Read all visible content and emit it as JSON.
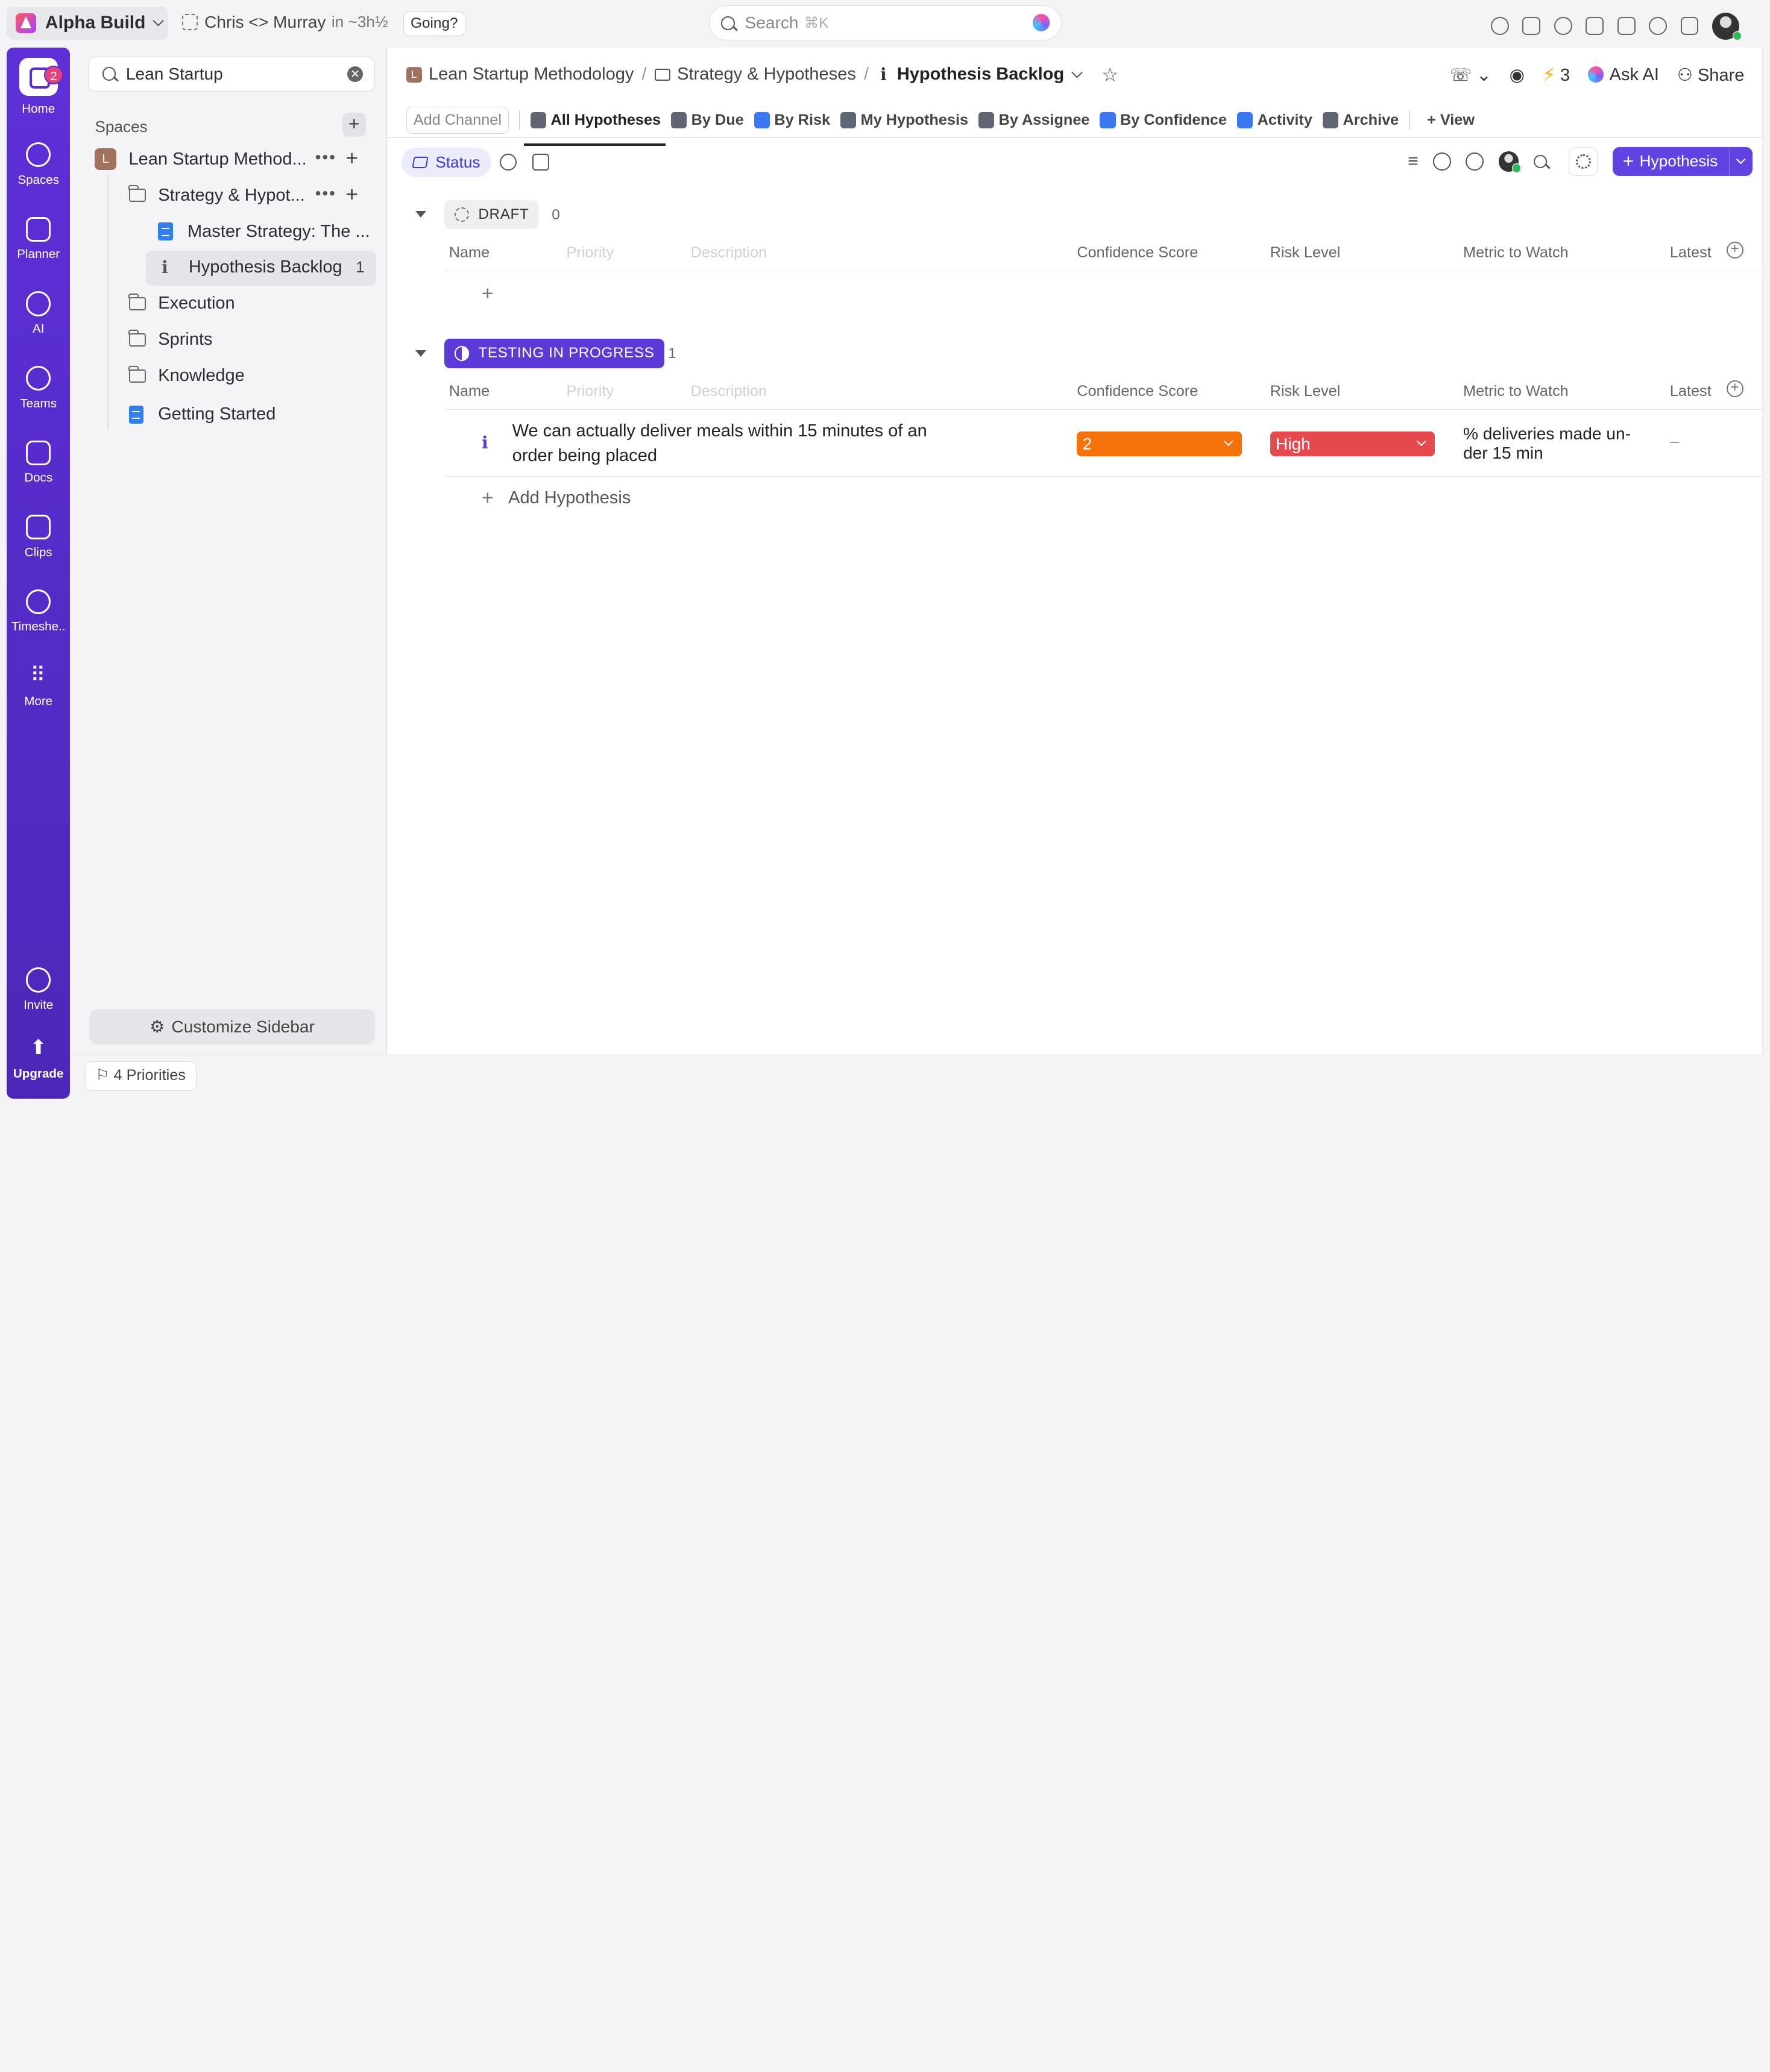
{
  "topbar": {
    "workspace": "Alpha Build",
    "meeting": "Chris <> Murray",
    "meeting_time": "in ~3h½",
    "going": "Going?",
    "search_placeholder": "Search",
    "search_shortcut": "⌘K"
  },
  "rail": {
    "badge": "2",
    "items": [
      "Home",
      "Spaces",
      "Planner",
      "AI",
      "Teams",
      "Docs",
      "Clips",
      "Timeshe..",
      "More"
    ],
    "invite": "Invite",
    "upgrade": "Upgrade"
  },
  "sidebar": {
    "search_value": "Lean Startup",
    "spaces_heading": "Spaces",
    "space_initial": "L",
    "space_name": "Lean Startup Method...",
    "folder_name": "Strategy & Hypot...",
    "doc_master": "Master Strategy: The ...",
    "list_selected": "Hypothesis Backlog",
    "list_selected_count": "1",
    "items": [
      "Execution",
      "Sprints",
      "Knowledge",
      "Getting Started"
    ],
    "customize": "Customize Sidebar"
  },
  "bottom": {
    "priorities": "4 Priorities"
  },
  "header": {
    "crumb_space": "Lean Startup Methodology",
    "crumb_folder": "Strategy & Hypotheses",
    "crumb_list": "Hypothesis Backlog",
    "bolt_count": "3",
    "ask_ai": "Ask AI",
    "share": "Share"
  },
  "tabs": {
    "add_channel": "Add Channel",
    "items": [
      "All Hypotheses",
      "By Due",
      "By Risk",
      "My Hypothesis",
      "By Assignee",
      "By Confidence",
      "Activity",
      "Archive"
    ],
    "view": "View"
  },
  "toolbar": {
    "status": "Status",
    "new_button": "Hypothesis"
  },
  "columns": {
    "name": "Name",
    "priority": "Priority",
    "description": "Description",
    "confidence": "Confidence Score",
    "risk": "Risk Level",
    "metric": "Metric to Watch",
    "latest": "Latest"
  },
  "groups": [
    {
      "status": "DRAFT",
      "count": "0"
    },
    {
      "status": "TESTING IN PROGRESS",
      "count": "1"
    }
  ],
  "task": {
    "name": "We can actually deliver meals within 15 minutes of an order being placed",
    "confidence": "2",
    "confidence_color": "#f5720b",
    "risk": "High",
    "risk_color": "#e5484d",
    "metric": "% deliveries made un-der 15 min",
    "latest": "–"
  },
  "add_hypothesis": "Add Hypothesis",
  "colors": {
    "accent": "#6043e2",
    "testing": "#5b3ad8"
  }
}
